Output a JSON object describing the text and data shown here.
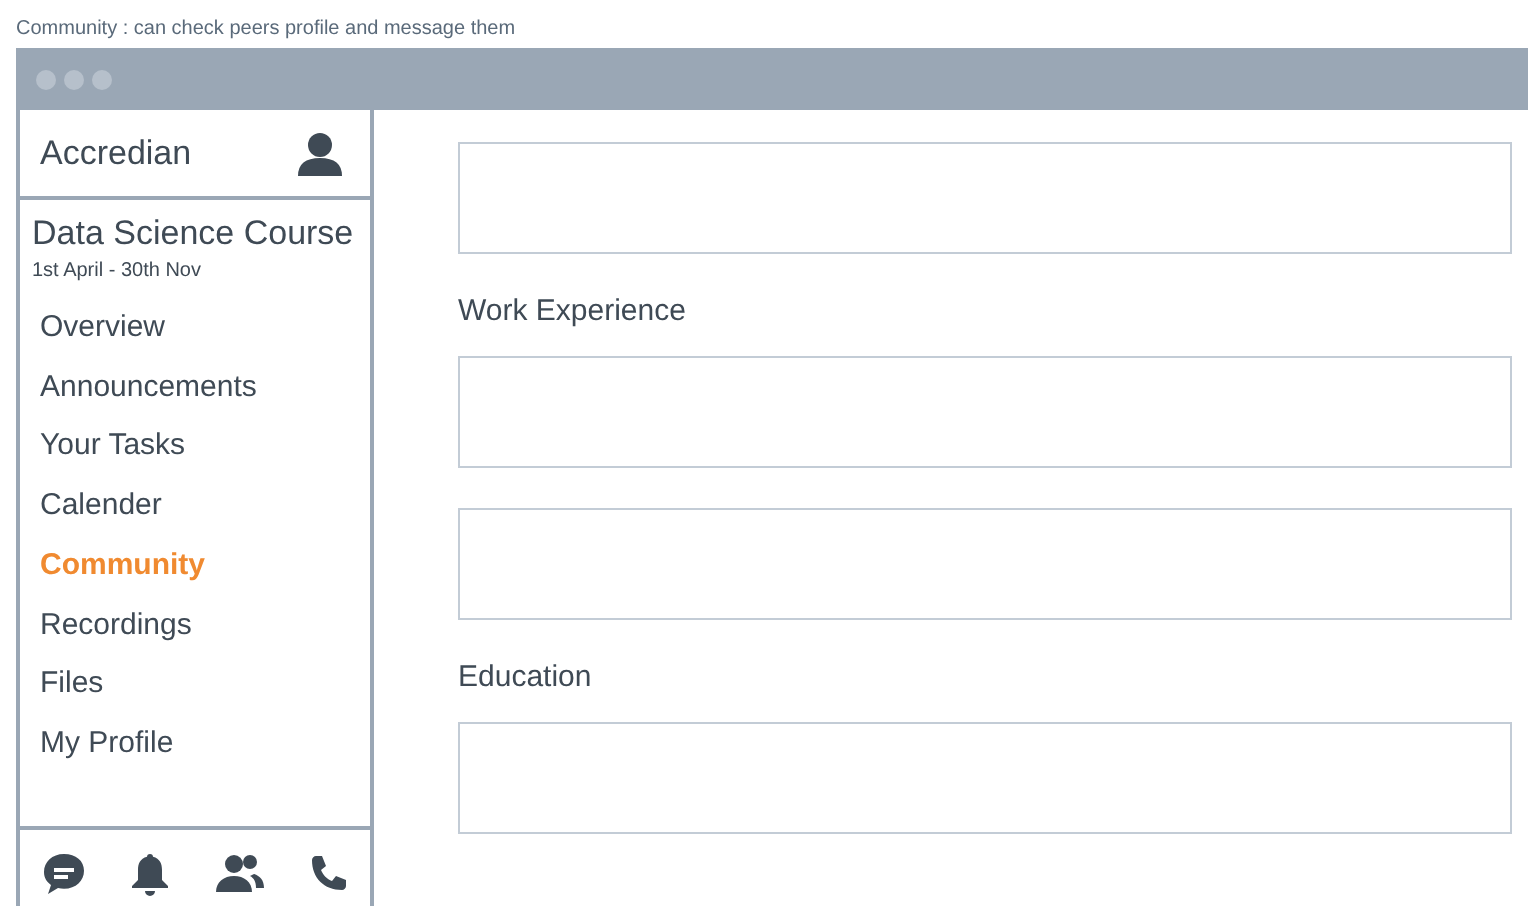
{
  "caption": "Community : can check peers profile and message them",
  "sidebar": {
    "brand": "Accredian",
    "course": {
      "title": "Data Science Course",
      "dates": "1st April - 30th Nov"
    },
    "items": [
      {
        "label": "Overview",
        "selected": false
      },
      {
        "label": "Announcements",
        "selected": false
      },
      {
        "label": "Your Tasks",
        "selected": false
      },
      {
        "label": "Calender",
        "selected": false
      },
      {
        "label": "Community",
        "selected": true
      },
      {
        "label": "Recordings",
        "selected": false
      },
      {
        "label": "Files",
        "selected": false
      },
      {
        "label": "My Profile",
        "selected": false
      }
    ]
  },
  "main": {
    "blocks": [
      {
        "kind": "field"
      },
      {
        "kind": "heading",
        "text": "Work Experience"
      },
      {
        "kind": "field"
      },
      {
        "kind": "field"
      },
      {
        "kind": "heading",
        "text": "Education"
      },
      {
        "kind": "field"
      }
    ]
  }
}
